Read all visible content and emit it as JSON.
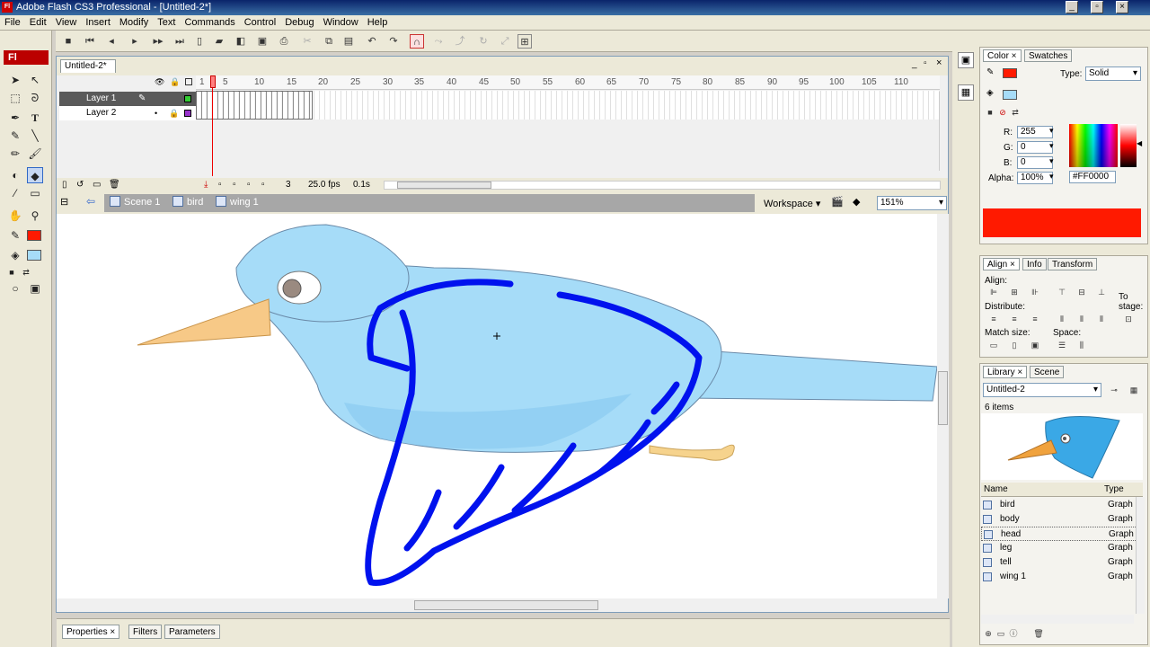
{
  "app": {
    "title": "Adobe Flash CS3 Professional - [Untitled-2*]",
    "logo": "Fl"
  },
  "menu": [
    "File",
    "Edit",
    "View",
    "Insert",
    "Modify",
    "Text",
    "Commands",
    "Control",
    "Debug",
    "Window",
    "Help"
  ],
  "document": {
    "tab_label": "Untitled-2*"
  },
  "timeline": {
    "frame_numbers": [
      "1",
      "5",
      "10",
      "15",
      "20",
      "25",
      "30",
      "35",
      "40",
      "45",
      "50",
      "55",
      "60",
      "65",
      "70",
      "75",
      "80",
      "85",
      "90",
      "95",
      "100",
      "105",
      "110"
    ],
    "layers": [
      {
        "name": "Layer 1",
        "selected": true,
        "color": "#33cc33"
      },
      {
        "name": "Layer 2",
        "selected": false,
        "color": "#9933cc"
      }
    ],
    "current_frame": "3",
    "fps": "25.0 fps",
    "time": "0.1s"
  },
  "editbar": {
    "scene": "Scene 1",
    "breadcrumb": [
      "bird",
      "wing 1"
    ],
    "workspace_label": "Workspace",
    "zoom": "151%"
  },
  "properties": {
    "tabs": [
      "Properties",
      "Filters",
      "Parameters"
    ]
  },
  "color_panel": {
    "tabs": [
      "Color",
      "Swatches"
    ],
    "type_label": "Type:",
    "type_value": "Solid",
    "r_label": "R:",
    "r": "255",
    "g_label": "G:",
    "g": "0",
    "b_label": "B:",
    "b": "0",
    "alpha_label": "Alpha:",
    "alpha": "100%",
    "hex": "#FF0000",
    "swatch_color": "#ff1a00"
  },
  "align_panel": {
    "tabs": [
      "Align",
      "Info",
      "Transform"
    ],
    "align": "Align:",
    "distribute": "Distribute:",
    "match_size": "Match size:",
    "space": "Space:",
    "to_stage": "To stage:"
  },
  "library": {
    "tabs": [
      "Library",
      "Scene"
    ],
    "document": "Untitled-2",
    "count": "6 items",
    "col_name": "Name",
    "col_type": "Type",
    "items": [
      {
        "name": "bird",
        "type": "Graph"
      },
      {
        "name": "body",
        "type": "Graph"
      },
      {
        "name": "head",
        "type": "Graph"
      },
      {
        "name": "leg",
        "type": "Graph"
      },
      {
        "name": "tell",
        "type": "Graph"
      },
      {
        "name": "wing 1",
        "type": "Graph"
      }
    ],
    "selected_index": 2
  }
}
